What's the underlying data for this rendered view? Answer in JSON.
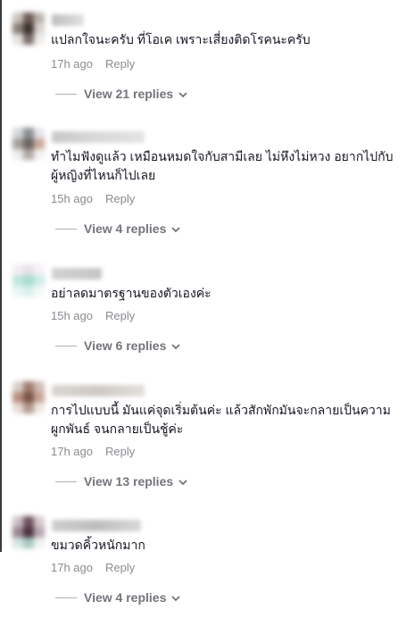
{
  "comments": [
    {
      "text": "แปลกใจนะครับ ที่โอเค เพราะเสี่ยงติดโรคนะครับ",
      "time": "17h ago",
      "reply_label": "Reply",
      "view_replies": "View 21 replies"
    },
    {
      "text": "ทำไมฟังดูแล้ว เหมือนหมดใจกับสามีเลย ไม่หึงไม่หวง อยากไปกับผู้หญิงที่ไหนก็ไปเลย",
      "time": "15h ago",
      "reply_label": "Reply",
      "view_replies": "View 4 replies"
    },
    {
      "text": "อย่าลดมาตรฐานของตัวเองค่ะ",
      "time": "15h ago",
      "reply_label": "Reply",
      "view_replies": "View 6 replies"
    },
    {
      "text": "การไปแบบนี้ มันแค่จุดเริ่มต้นค่ะ แล้วสักพักมันจะกลายเป็นความผูกพันธ์ จนกลายเป็นชู้ค่ะ",
      "time": "17h ago",
      "reply_label": "Reply",
      "view_replies": "View 13 replies"
    },
    {
      "text": "ขมวดคิ้วหนักมาก",
      "time": "17h ago",
      "reply_label": "Reply",
      "view_replies": "View 4 replies"
    }
  ],
  "icons": {
    "expand": "chevron-down-icon"
  },
  "colors": {
    "meta": "#8a8b91",
    "view_replies": "#73747b",
    "text": "#161823"
  }
}
